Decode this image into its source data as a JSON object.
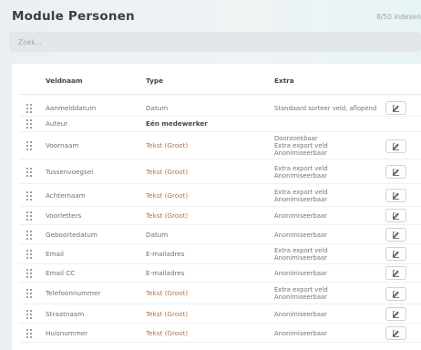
{
  "header": {
    "title": "Module Personen",
    "count": "8/50 indexen"
  },
  "search": {
    "placeholder": "Zoek..."
  },
  "table": {
    "columns": [
      "Veldnaam",
      "Type",
      "Extra"
    ],
    "rows": [
      {
        "name": "Aanmelddatum",
        "type": "Datum",
        "extra": [
          "Standaard sorteer veld, aflopend"
        ]
      },
      {
        "name": "Auteur",
        "type": "Eén medewerker",
        "extra": []
      },
      {
        "name": "Voornaam",
        "type": "Tekst (Groot)",
        "extra": [
          "Doorzoekbaar",
          "Extra export veld",
          "Anonimiseerbaar"
        ]
      },
      {
        "name": "Tussenvoegsel",
        "type": "Tekst (Groot)",
        "extra": [
          "Extra export veld",
          "Anonimiseerbaar"
        ]
      },
      {
        "name": "Achternaam",
        "type": "Tekst (Groot)",
        "extra": [
          "Extra export veld",
          "Anonimiseerbaar"
        ]
      },
      {
        "name": "Voorletters",
        "type": "Tekst (Groot)",
        "extra": [
          "Anonimiseerbaar"
        ]
      },
      {
        "name": "Geboortedatum",
        "type": "Datum",
        "extra": [
          "Anonimiseerbaar"
        ]
      },
      {
        "name": "Email",
        "type": "E-mailadres",
        "extra": [
          "Extra export veld",
          "Anonimiseerbaar"
        ]
      },
      {
        "name": "Email CC",
        "type": "E-mailadres",
        "extra": [
          "Anonimiseerbaar"
        ]
      },
      {
        "name": "Telefoonnummer",
        "type": "Tekst (Groot)",
        "extra": [
          "Extra export veld",
          "Anonimiseerbaar"
        ]
      },
      {
        "name": "Straatnaam",
        "type": "Tekst (Groot)",
        "extra": [
          "Anonimiseerbaar"
        ]
      },
      {
        "name": "Huisnummer",
        "type": "Tekst (Groot)",
        "extra": [
          "Anonimiseerbaar"
        ]
      }
    ]
  },
  "colors": {
    "accent_type": "#b0754a",
    "text": "#6b7178",
    "heading": "#3a3f47"
  },
  "icons": {
    "drag": "drag-handle-icon",
    "edit": "edit-icon"
  }
}
